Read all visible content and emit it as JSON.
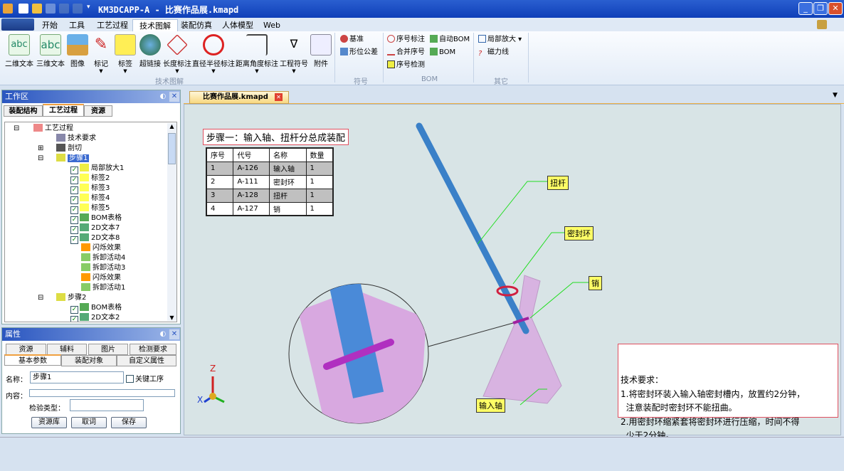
{
  "window": {
    "title": "KM3DCAPP-A - 比赛作品展.kmapd"
  },
  "ribbon_tabs": [
    "开始",
    "工具",
    "工艺过程",
    "技术图解",
    "装配仿真",
    "人体模型",
    "Web"
  ],
  "active_tab": "技术图解",
  "ribbon": {
    "tech_buttons": [
      "二维文本",
      "三维文本",
      "图像",
      "标记",
      "标签",
      "超链接",
      "长度标注",
      "直径半径标注",
      "距离角度标注",
      "工程符号",
      "附件"
    ],
    "tech_group": "技术图解",
    "symbol_items": [
      "基准",
      "形位公差"
    ],
    "symbol_group": "符号",
    "bom_items": [
      "序号标注",
      "合并序号",
      "序号检测",
      "自动BOM",
      "BOM"
    ],
    "bom_group": "BOM",
    "other_items": [
      "局部放大",
      "磁力线"
    ],
    "other_group": "其它"
  },
  "workspace": {
    "title": "工作区",
    "tabs": [
      "装配结构",
      "工艺过程",
      "资源"
    ],
    "active_tab": "工艺过程",
    "tree": [
      "工艺过程",
      "技术要求",
      "剖切",
      "步骤1",
      "局部放大1",
      "标签2",
      "标签3",
      "标签4",
      "标签5",
      "BOM表格",
      "2D文本7",
      "2D文本8",
      "闪烁效果",
      "拆卸活动4",
      "拆卸活动3",
      "闪烁效果",
      "拆卸活动1",
      "步骤2",
      "BOM表格",
      "2D文本2"
    ]
  },
  "properties": {
    "title": "属性",
    "tabs_row1": [
      "资源",
      "辅料",
      "图片",
      "检测要求"
    ],
    "tabs_row2": [
      "基本参数",
      "装配对象",
      "自定义属性"
    ],
    "name_label": "名称：",
    "name_value": "步骤1",
    "key_process_label": "关键工序",
    "key_process_checked": false,
    "content_label": "内容：",
    "content_value": "",
    "inspect_label": "检验类型：",
    "inspect_value": "",
    "buttons": [
      "资源库",
      "取词",
      "保存"
    ]
  },
  "document": {
    "tab": "比赛作品展.kmapd",
    "step_title": "步骤一：输入轴、扭杆分总成装配",
    "bom_headers": [
      "序号",
      "代号",
      "名称",
      "数量"
    ],
    "bom_rows": [
      [
        "1",
        "A-126",
        "输入轴",
        "1"
      ],
      [
        "2",
        "A-111",
        "密封环",
        "1"
      ],
      [
        "3",
        "A-128",
        "扭杆",
        "1"
      ],
      [
        "4",
        "A-127",
        "销",
        "1"
      ]
    ],
    "labels": [
      "扭杆",
      "密封环",
      "销",
      "输入轴"
    ],
    "tech_req": [
      "技术要求：",
      "1.将密封环装入输入轴密封槽内，放置约2分钟，",
      "  注意装配时密封环不能扭曲。",
      "2.用密封环缩紧套将密封环进行压缩，时间不得",
      "  少于2分钟。"
    ],
    "axes": [
      "Z",
      "X"
    ]
  }
}
